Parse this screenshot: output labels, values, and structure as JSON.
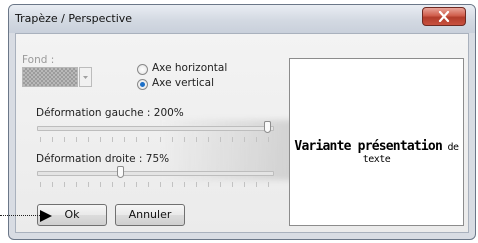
{
  "window": {
    "title": "Trapèze / Perspective"
  },
  "fill": {
    "label": "Fond :"
  },
  "axis": {
    "options": [
      "Axe horizontal",
      "Axe vertical"
    ],
    "selected": "Axe vertical"
  },
  "left_deformation": {
    "label": "Déformation gauche : 200%",
    "value_percent": 200
  },
  "right_deformation": {
    "label": "Déformation droite : 75%",
    "value_percent": 75
  },
  "preview": {
    "text_big": "Variante présentation",
    "text_small": "de texte"
  },
  "buttons": {
    "ok": "Ok",
    "cancel": "Annuler"
  },
  "icons": {
    "close": "close-icon",
    "dropdown": "chevron-down-icon",
    "pointer": "arrow-pointer-icon"
  },
  "colors": {
    "radio_selected": "#1d6fc7",
    "close_button": "#c9513f"
  }
}
